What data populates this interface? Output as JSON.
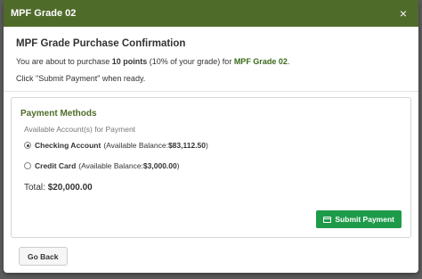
{
  "modal": {
    "title": "MPF Grade 02",
    "close_symbol": "×"
  },
  "confirmation": {
    "heading": "MPF Grade Purchase Confirmation",
    "line1_prefix": "You are about to purchase ",
    "line1_points": "10 points",
    "line1_middle": " (10% of your grade) for ",
    "line1_grade": "MPF Grade 02",
    "line1_suffix": ".",
    "line2": "Click \"Submit Payment\" when ready."
  },
  "payment": {
    "title": "Payment Methods",
    "subtitle": "Available Account(s) for Payment",
    "options": [
      {
        "name": "Checking Account",
        "detail_prefix": "(Available Balance: ",
        "balance": "$83,112.50",
        "detail_suffix": ")",
        "selected": true
      },
      {
        "name": "Credit Card",
        "detail_prefix": "(Available Balance: ",
        "balance": "$3,000.00",
        "detail_suffix": ")",
        "selected": false
      }
    ],
    "total_label": "Total: ",
    "total_value": "$20,000.00",
    "submit_label": "Submit Payment",
    "submit_icon": "credit-card-icon"
  },
  "footer": {
    "back_label": "Go Back"
  },
  "colors": {
    "header_bg": "#4f6b2a",
    "submit_bg": "#1e9b4a",
    "accent_text": "#4f6b2a"
  }
}
